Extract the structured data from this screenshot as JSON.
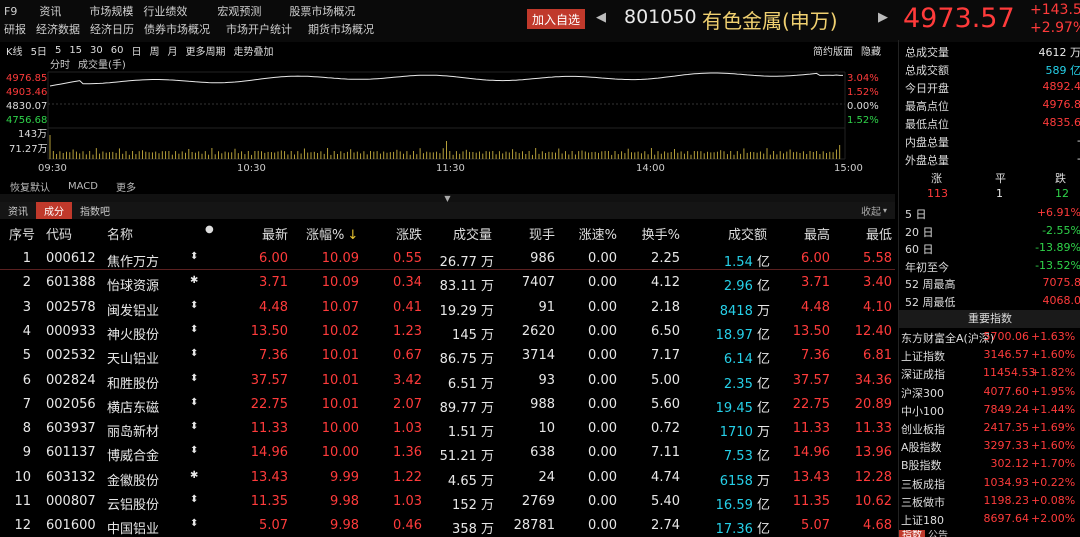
{
  "topbar": {
    "key": "F9",
    "menu1": [
      "资讯",
      "市场规模",
      "行业绩效",
      "宏观预测",
      "股票市场概况"
    ],
    "key2": "研报",
    "menu2": [
      "经济数据",
      "经济日历",
      "债券市场概况",
      "市场开户统计",
      "期货市场概况"
    ],
    "add_fav": "加入自选",
    "code": "801050",
    "name": "有色金属(申万)",
    "price": "4973.57",
    "change": "+143.5",
    "change_pct": "+2.97%",
    "prev_icon": "◀",
    "next_icon": "▶"
  },
  "toolbar": {
    "items": [
      "K线",
      "5日",
      "5",
      "15",
      "30",
      "60",
      "日",
      "周",
      "月",
      "更多周期",
      "走势叠加"
    ],
    "simple": "简约版面",
    "hide": "隐藏"
  },
  "chart": {
    "labels": {
      "time": "分时",
      "vol": "成交量(手)"
    },
    "y_left": [
      "4976.85",
      "4903.46",
      "4830.07",
      "4756.68"
    ],
    "y_right": [
      "3.04%",
      "1.52%",
      "0.00%",
      "1.52%"
    ],
    "vol_labels": [
      "143万",
      "71.27万"
    ],
    "x_labels": [
      "09:30",
      "10:30",
      "11:30",
      "14:00",
      "15:00"
    ],
    "colors": {
      "price_line": "#e8e8e8",
      "vol_bar": "#c8b040",
      "up": "#ff3b3b",
      "down": "#2fd34a"
    }
  },
  "chart_menu": [
    "恢复默认",
    "MACD",
    "更多"
  ],
  "tabs": [
    "资讯",
    "成分",
    "指数吧"
  ],
  "collapse": "收起",
  "table": {
    "headers": [
      "序号",
      "代码",
      "名称",
      "●",
      "最新",
      "涨幅%",
      "涨跌",
      "成交量",
      "现手",
      "涨速%",
      "换手%",
      "成交额",
      "最高",
      "最低"
    ],
    "sort_icon": "↓",
    "rows": [
      {
        "idx": "1",
        "code": "000612",
        "name": "焦作万方",
        "flag": "⬍",
        "last": "6.00",
        "pct": "10.09",
        "chg": "0.55",
        "vol": "26.77 万",
        "cur": "986",
        "spd": "0.00",
        "turn": "2.25",
        "amt": "1.54",
        "amt_u": "亿",
        "high": "6.00",
        "low": "5.58"
      },
      {
        "idx": "2",
        "code": "601388",
        "name": "怡球资源",
        "flag": "✱",
        "last": "3.71",
        "pct": "10.09",
        "chg": "0.34",
        "vol": "83.11 万",
        "cur": "7407",
        "spd": "0.00",
        "turn": "4.12",
        "amt": "2.96",
        "amt_u": "亿",
        "high": "3.71",
        "low": "3.40"
      },
      {
        "idx": "3",
        "code": "002578",
        "name": "闽发铝业",
        "flag": "⬍",
        "last": "4.48",
        "pct": "10.07",
        "chg": "0.41",
        "vol": "19.29 万",
        "cur": "91",
        "spd": "0.00",
        "turn": "2.18",
        "amt": "8418",
        "amt_u": "万",
        "high": "4.48",
        "low": "4.10"
      },
      {
        "idx": "4",
        "code": "000933",
        "name": "神火股份",
        "flag": "⬍",
        "last": "13.50",
        "pct": "10.02",
        "chg": "1.23",
        "vol": "145 万",
        "cur": "2620",
        "spd": "0.00",
        "turn": "6.50",
        "amt": "18.97",
        "amt_u": "亿",
        "high": "13.50",
        "low": "12.40"
      },
      {
        "idx": "5",
        "code": "002532",
        "name": "天山铝业",
        "flag": "⬍",
        "last": "7.36",
        "pct": "10.01",
        "chg": "0.67",
        "vol": "86.75 万",
        "cur": "3714",
        "spd": "0.00",
        "turn": "7.17",
        "amt": "6.14",
        "amt_u": "亿",
        "high": "7.36",
        "low": "6.81"
      },
      {
        "idx": "6",
        "code": "002824",
        "name": "和胜股份",
        "flag": "⬍",
        "last": "37.57",
        "pct": "10.01",
        "chg": "3.42",
        "vol": "6.51 万",
        "cur": "93",
        "spd": "0.00",
        "turn": "5.00",
        "amt": "2.35",
        "amt_u": "亿",
        "high": "37.57",
        "low": "34.36"
      },
      {
        "idx": "7",
        "code": "002056",
        "name": "横店东磁",
        "flag": "⬍",
        "last": "22.75",
        "pct": "10.01",
        "chg": "2.07",
        "vol": "89.77 万",
        "cur": "988",
        "spd": "0.00",
        "turn": "5.60",
        "amt": "19.45",
        "amt_u": "亿",
        "high": "22.75",
        "low": "20.89"
      },
      {
        "idx": "8",
        "code": "603937",
        "name": "丽岛新材",
        "flag": "⬍",
        "last": "11.33",
        "pct": "10.00",
        "chg": "1.03",
        "vol": "1.51 万",
        "cur": "10",
        "spd": "0.00",
        "turn": "0.72",
        "amt": "1710",
        "amt_u": "万",
        "high": "11.33",
        "low": "11.33"
      },
      {
        "idx": "9",
        "code": "601137",
        "name": "博威合金",
        "flag": "⬍",
        "last": "14.96",
        "pct": "10.00",
        "chg": "1.36",
        "vol": "51.21 万",
        "cur": "638",
        "spd": "0.00",
        "turn": "7.11",
        "amt": "7.53",
        "amt_u": "亿",
        "high": "14.96",
        "low": "13.96"
      },
      {
        "idx": "10",
        "code": "603132",
        "name": "金徽股份",
        "flag": "✱",
        "last": "13.43",
        "pct": "9.99",
        "chg": "1.22",
        "vol": "4.65 万",
        "cur": "24",
        "spd": "0.00",
        "turn": "4.74",
        "amt": "6158",
        "amt_u": "万",
        "high": "13.43",
        "low": "12.28"
      },
      {
        "idx": "11",
        "code": "000807",
        "name": "云铝股份",
        "flag": "⬍",
        "last": "11.35",
        "pct": "9.98",
        "chg": "1.03",
        "vol": "152 万",
        "cur": "2769",
        "spd": "0.00",
        "turn": "5.40",
        "amt": "16.59",
        "amt_u": "亿",
        "high": "11.35",
        "low": "10.62"
      },
      {
        "idx": "12",
        "code": "601600",
        "name": "中国铝业",
        "flag": "⬍",
        "last": "5.07",
        "pct": "9.98",
        "chg": "0.46",
        "vol": "358 万",
        "cur": "28781",
        "spd": "0.00",
        "turn": "2.74",
        "amt": "17.36",
        "amt_u": "亿",
        "high": "5.07",
        "low": "4.68"
      }
    ]
  },
  "right": {
    "stats": [
      {
        "label": "总成交量",
        "value": "4612 万",
        "color": "white"
      },
      {
        "label": "总成交额",
        "value": "589 亿",
        "color": "cyan"
      },
      {
        "label": "今日开盘",
        "value": "4892.4",
        "color": "red"
      },
      {
        "label": "最高点位",
        "value": "4976.8",
        "color": "red"
      },
      {
        "label": "最低点位",
        "value": "4835.6",
        "color": "red"
      },
      {
        "label": "内盘总量",
        "value": "-",
        "color": "white"
      },
      {
        "label": "外盘总量",
        "value": "-",
        "color": "white"
      }
    ],
    "breadth_labels": [
      "涨",
      "平",
      "跌"
    ],
    "breadth_values": [
      "113",
      "1",
      "12"
    ],
    "perf": [
      {
        "label": "5 日",
        "value": "+6.91%",
        "color": "red"
      },
      {
        "label": "20 日",
        "value": "-2.55%",
        "color": "green"
      },
      {
        "label": "60 日",
        "value": "-13.89%",
        "color": "green"
      },
      {
        "label": "年初至今",
        "value": "-13.52%",
        "color": "green"
      },
      {
        "label": "52 周最高",
        "value": "7075.8",
        "color": "red"
      },
      {
        "label": "52 周最低",
        "value": "4068.0",
        "color": "red"
      }
    ],
    "index_title": "重要指数",
    "indices": [
      {
        "name": "东方财富全A(沪深)",
        "price": "5700.06",
        "chg": "+1.63%"
      },
      {
        "name": "上证指数",
        "price": "3146.57",
        "chg": "+1.60%"
      },
      {
        "name": "深证成指",
        "price": "11454.53",
        "chg": "+1.82%"
      },
      {
        "name": "沪深300",
        "price": "4077.60",
        "chg": "+1.95%"
      },
      {
        "name": "中小100",
        "price": "7849.24",
        "chg": "+1.44%"
      },
      {
        "name": "创业板指",
        "price": "2417.35",
        "chg": "+1.69%"
      },
      {
        "name": "A股指数",
        "price": "3297.33",
        "chg": "+1.60%"
      },
      {
        "name": "B股指数",
        "price": "302.12",
        "chg": "+1.70%"
      },
      {
        "name": "三板成指",
        "price": "1034.93",
        "chg": "+0.22%"
      },
      {
        "name": "三板做市",
        "price": "1198.23",
        "chg": "+0.08%"
      },
      {
        "name": "上证180",
        "price": "8697.64",
        "chg": "+2.00%"
      }
    ],
    "bottom_tabs": [
      "指数",
      "公告"
    ]
  }
}
